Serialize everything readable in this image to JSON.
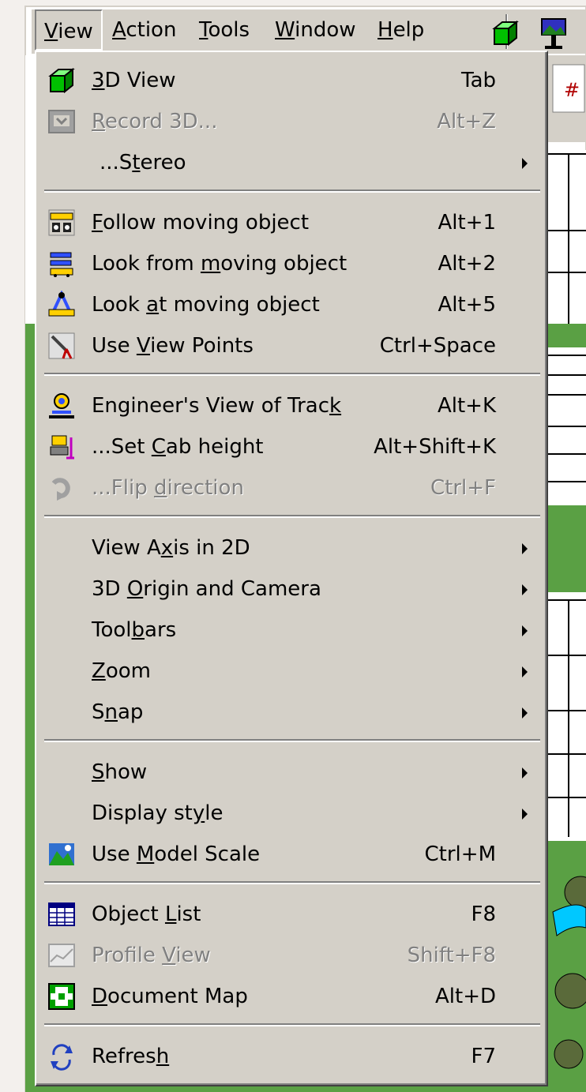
{
  "menubar": {
    "items": [
      {
        "label": "View",
        "mnemonic": "V",
        "rest": "iew"
      },
      {
        "label": "Action",
        "mnemonic": "A",
        "rest": "ction"
      },
      {
        "label": "Tools",
        "mnemonic": "T",
        "rest": "ools"
      },
      {
        "label": "Window",
        "mnemonic": "W",
        "rest": "indow"
      },
      {
        "label": "Help",
        "mnemonic": "H",
        "rest": "elp"
      }
    ],
    "toolbar_icons": [
      "3d-cube-icon",
      "scenery-icon"
    ]
  },
  "view_menu": {
    "items": [
      {
        "pre": "",
        "mn": "3",
        "post": "D View",
        "shortcut": "Tab",
        "icon": "green-cube-icon",
        "enabled": true
      },
      {
        "pre": "",
        "mn": "R",
        "post": "ecord 3D...",
        "shortcut": "Alt+Z",
        "icon": "record-icon",
        "enabled": false
      },
      {
        "pre": "...S",
        "mn": "t",
        "post": "ereo",
        "shortcut": "",
        "icon": "",
        "enabled": true,
        "submenu": true,
        "indent": true
      },
      {
        "pre": "",
        "mn": "F",
        "post": "ollow moving object",
        "shortcut": "Alt+1",
        "icon": "follow-object-icon",
        "enabled": true
      },
      {
        "pre": "Look from ",
        "mn": "m",
        "post": "oving object",
        "shortcut": "Alt+2",
        "icon": "look-from-object-icon",
        "enabled": true
      },
      {
        "pre": "Look ",
        "mn": "a",
        "post": "t moving object",
        "shortcut": "Alt+5",
        "icon": "look-at-object-icon",
        "enabled": true
      },
      {
        "pre": "Use ",
        "mn": "V",
        "post": "iew Points",
        "shortcut": "Ctrl+Space",
        "icon": "view-points-icon",
        "enabled": true
      },
      {
        "pre": "Engineer's View of Trac",
        "mn": "k",
        "post": "",
        "shortcut": "Alt+K",
        "icon": "engineer-view-icon",
        "enabled": true
      },
      {
        "pre": "...Set ",
        "mn": "C",
        "post": "ab height",
        "shortcut": "Alt+Shift+K",
        "icon": "cab-height-icon",
        "enabled": true
      },
      {
        "pre": "...Flip ",
        "mn": "d",
        "post": "irection",
        "shortcut": "Ctrl+F",
        "icon": "flip-direction-icon",
        "enabled": false
      },
      {
        "pre": "View A",
        "mn": "x",
        "post": "is in 2D",
        "shortcut": "",
        "icon": "",
        "enabled": true,
        "submenu": true
      },
      {
        "pre": "3D ",
        "mn": "O",
        "post": "rigin and Camera",
        "shortcut": "",
        "icon": "",
        "enabled": true,
        "submenu": true
      },
      {
        "pre": "Tool",
        "mn": "b",
        "post": "ars",
        "shortcut": "",
        "icon": "",
        "enabled": true,
        "submenu": true
      },
      {
        "pre": "",
        "mn": "Z",
        "post": "oom",
        "shortcut": "",
        "icon": "",
        "enabled": true,
        "submenu": true
      },
      {
        "pre": "S",
        "mn": "n",
        "post": "ap",
        "shortcut": "",
        "icon": "",
        "enabled": true,
        "submenu": true
      },
      {
        "pre": "",
        "mn": "S",
        "post": "how",
        "shortcut": "",
        "icon": "",
        "enabled": true,
        "submenu": true
      },
      {
        "pre": "Display st",
        "mn": "y",
        "post": "le",
        "shortcut": "",
        "icon": "",
        "enabled": true,
        "submenu": true
      },
      {
        "pre": "Use ",
        "mn": "M",
        "post": "odel Scale",
        "shortcut": "Ctrl+M",
        "icon": "model-scale-icon",
        "enabled": true
      },
      {
        "pre": "Object ",
        "mn": "L",
        "post": "ist",
        "shortcut": "F8",
        "icon": "object-list-icon",
        "enabled": true
      },
      {
        "pre": "Profile ",
        "mn": "V",
        "post": "iew",
        "shortcut": "Shift+F8",
        "icon": "profile-view-icon",
        "enabled": false
      },
      {
        "pre": "",
        "mn": "D",
        "post": "ocument Map",
        "shortcut": "Alt+D",
        "icon": "document-map-icon",
        "enabled": true
      },
      {
        "pre": "Refres",
        "mn": "h",
        "post": "",
        "shortcut": "F7",
        "icon": "refresh-icon",
        "enabled": true
      }
    ]
  },
  "colors": {
    "menu_bg": "#d4d0c8",
    "disabled": "#808080",
    "grass": "#5aa044",
    "water": "#00c8ff"
  }
}
